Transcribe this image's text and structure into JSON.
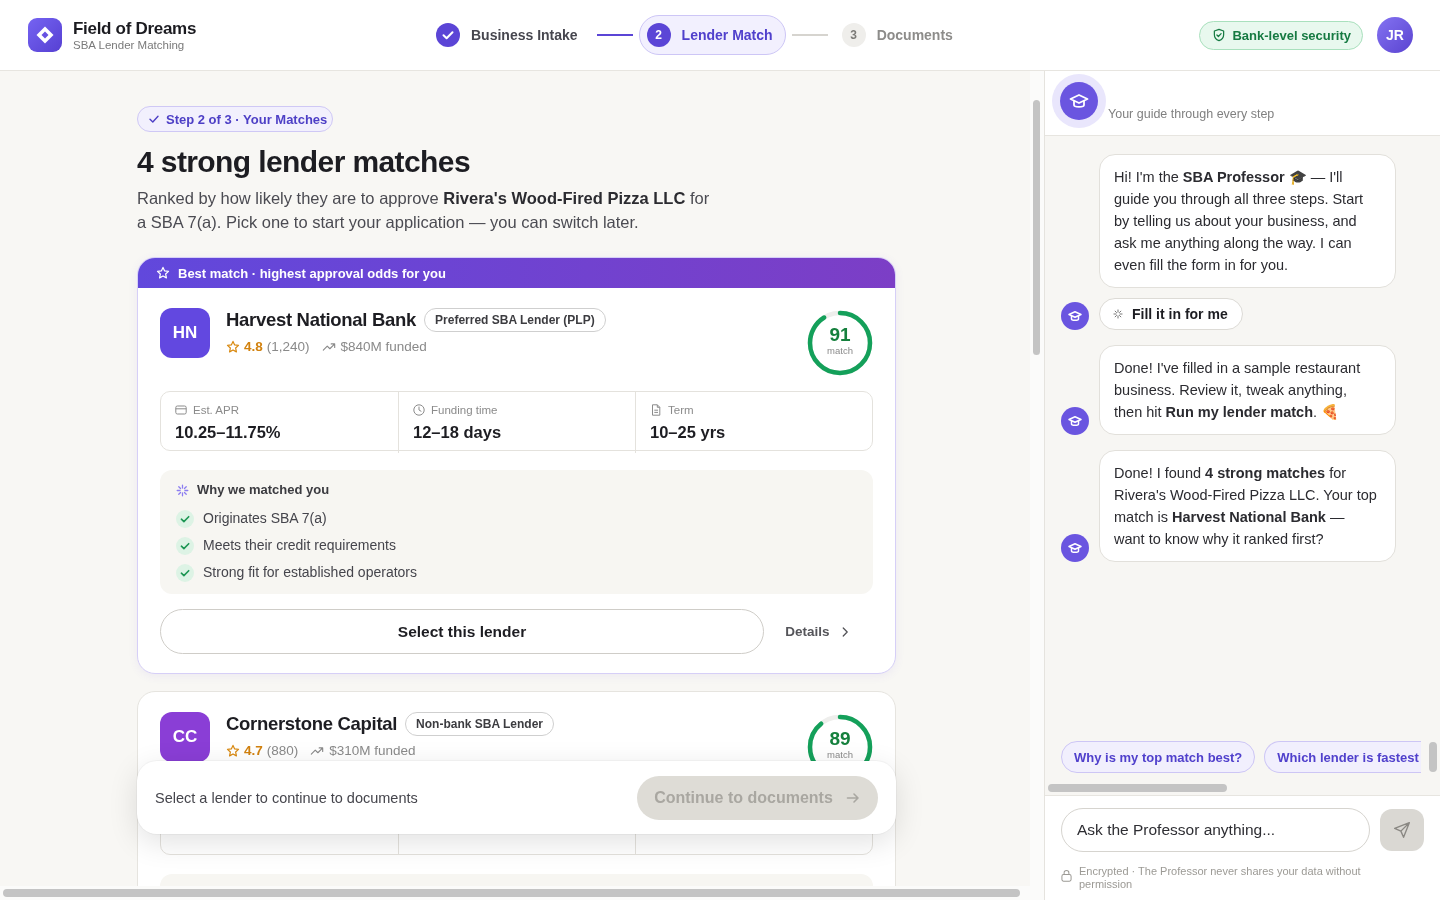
{
  "header": {
    "brand": {
      "name": "Field of Dreams",
      "tagline": "SBA Lender Matching"
    },
    "steps": [
      {
        "label": "Business Intake",
        "completed": true,
        "selected": false
      },
      {
        "number": "2",
        "label": "Lender Match",
        "completed": false,
        "selected": true
      },
      {
        "number": "3",
        "label": "Documents",
        "completed": false,
        "selected": false
      }
    ],
    "security_badge": "Bank-level security",
    "user_initials": "JR"
  },
  "main": {
    "step_chip": "Step 2 of 3 · Your Matches",
    "title": "4 strong lender matches",
    "intro": "Ranked by how likely they are to approve **Rivera's Wood-Fired Pizza LLC** for a SBA 7(a). Pick one to start your application — you can switch later.",
    "lenders": [
      {
        "banner": "Best match · highest approval odds for you",
        "initials": "HN",
        "color": "#6248e0",
        "name": "Harvest National Bank",
        "badge": "Preferred SBA Lender (PLP)",
        "rating": "4.8",
        "reviews": "(1,240)",
        "funded": "$840M funded",
        "score": "91",
        "score_label": "match",
        "level": 0.91,
        "stats": [
          {
            "kind": "apr",
            "label": "Est. APR",
            "value": "10.25–11.75%"
          },
          {
            "kind": "time",
            "label": "Funding time",
            "value": "12–18 days"
          },
          {
            "kind": "term",
            "label": "Term",
            "value": "10–25 yrs"
          }
        ],
        "reasons_title": "Why we matched you",
        "reasons": [
          "Originates SBA 7(a)",
          "Meets their credit requirements",
          "Strong fit for established operators"
        ],
        "select_label": "Select this lender",
        "details_label": "Details"
      },
      {
        "initials": "CC",
        "color": "#8a3ed6",
        "name": "Cornerstone Capital",
        "badge": "Non-bank SBA Lender",
        "rating": "4.7",
        "reviews": "(880)",
        "funded": "$310M funded",
        "score": "89",
        "score_label": "match",
        "level": 0.89
      }
    ],
    "footer": {
      "hint": "Select a lender to continue to documents",
      "button": {
        "label": "Continue to documents",
        "disabled": true
      }
    }
  },
  "chat": {
    "subtitle": "Your guide through every step",
    "items": [
      {
        "kind": "message",
        "text": "Hi! I'm the **SBA Professor** 🎓 — I'll guide you through all three steps. Start by telling us about your business, and ask me anything along the way. I can even fill the form in for you.",
        "avatar": false
      },
      {
        "kind": "action",
        "label": "Fill it in for me",
        "avatar": true
      },
      {
        "kind": "message",
        "text": "Done! I've filled in a sample restaurant business. Review it, tweak anything, then hit **Run my lender match**. 🍕",
        "avatar": true
      },
      {
        "kind": "message",
        "text": "Done! I found **4 strong matches** for Rivera's Wood-Fired Pizza LLC. Your top match is **Harvest National Bank** — want to know why it ranked first?",
        "avatar": true
      }
    ],
    "suggestions": [
      "Why is my top match best?",
      "Which lender is fastest"
    ],
    "input": {
      "placeholder": "Ask the Professor anything..."
    },
    "send": {
      "disabled": true
    },
    "footnote": "Encrypted · The Professor never shares your data without permission"
  }
}
